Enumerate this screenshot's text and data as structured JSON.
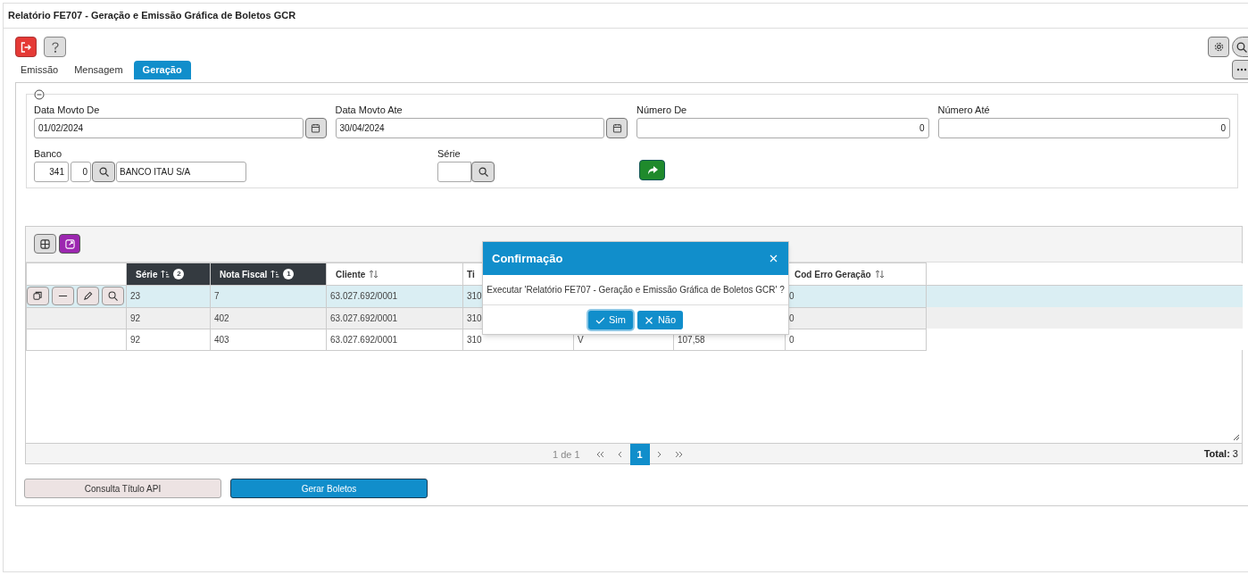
{
  "window": {
    "title": "Relatório FE707 - Geração e Emissão Gráfica de Boletos GCR"
  },
  "tabs": [
    {
      "label": "Emissão",
      "selected": false
    },
    {
      "label": "Mensagem",
      "selected": false
    },
    {
      "label": "Geração",
      "selected": true
    }
  ],
  "filters": {
    "fields": [
      {
        "label": "Data Movto De",
        "value": "01/02/2024",
        "kind": "date"
      },
      {
        "label": "Data Movto Ate",
        "value": "30/04/2024",
        "kind": "date"
      },
      {
        "label": "Número De",
        "value": "0",
        "kind": "number"
      },
      {
        "label": "Número Até",
        "value": "0",
        "kind": "number"
      }
    ],
    "banco": {
      "label": "Banco",
      "code": "341",
      "agency": "0",
      "name": "BANCO ITAU S/A"
    },
    "serie": {
      "label": "Série"
    }
  },
  "table": {
    "columns": [
      {
        "label": "Série",
        "sorted": true,
        "sort_rank": "2"
      },
      {
        "label": "Nota Fiscal",
        "sorted": true,
        "sort_rank": "1"
      },
      {
        "label": "Cliente",
        "sorted": false
      },
      {
        "label": "Ti"
      },
      {},
      {},
      {
        "label": "Cod Erro Geração",
        "sorted": false
      }
    ],
    "rows": [
      {
        "selected": true,
        "cells": [
          "23",
          "7",
          "63.027.692/0001",
          "310",
          null,
          null,
          "0"
        ]
      },
      {
        "selected": false,
        "cells": [
          "92",
          "402",
          "63.027.692/0001",
          "310",
          null,
          null,
          "0"
        ]
      },
      {
        "selected": false,
        "cells": [
          "92",
          "403",
          "63.027.692/0001",
          "310",
          "V",
          "107,58",
          "0"
        ]
      }
    ]
  },
  "pagination": {
    "summary": "1 de 1",
    "pages": [
      {
        "label": "1",
        "selected": true
      }
    ],
    "total": "**Total:** 3"
  },
  "buttons": [
    {
      "label": "Consulta Título API",
      "kind": "secondary"
    },
    {
      "label": "Gerar Boletos",
      "kind": "primary"
    }
  ],
  "dialog": {
    "title": "Confirmação",
    "message": "Executar 'Relatório FE707 - Geração e Emissão Gráfica de Boletos GCR' ?",
    "buttons": [
      {
        "label": "Sim",
        "kind": "confirm",
        "focused": true
      },
      {
        "label": "Não",
        "kind": "cancel",
        "focused": false
      }
    ]
  }
}
